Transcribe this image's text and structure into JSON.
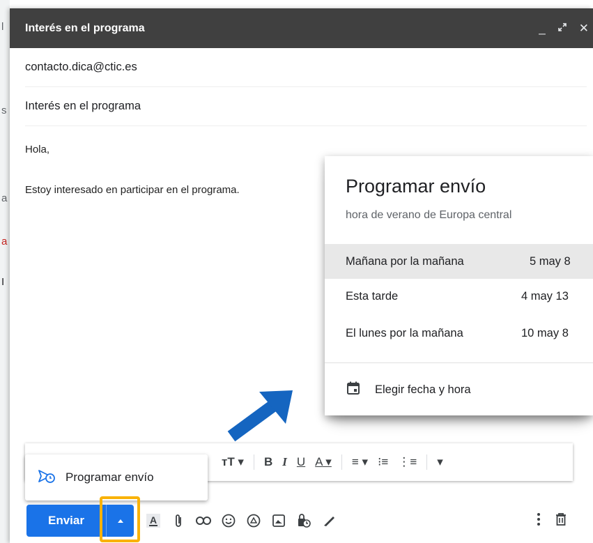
{
  "compose": {
    "title": "Interés en el programa",
    "to": "contacto.dica@ctic.es",
    "subject": "Interés en el programa",
    "body_greeting": "Hola,",
    "body_line": "Estoy interesado en participar en el programa."
  },
  "schedule_panel": {
    "title": "Programar envío",
    "timezone": "hora de verano de Europa central",
    "options": [
      {
        "label": "Mañana por la mañana",
        "time": "5 may 8"
      },
      {
        "label": "Esta tarde",
        "time": "4 may 13"
      },
      {
        "label": "El lunes por la mañana",
        "time": "10 may 8"
      }
    ],
    "custom_label": "Elegir fecha y hora"
  },
  "send_menu": {
    "item_label": "Programar envío"
  },
  "toolbar": {
    "send_label": "Enviar"
  },
  "colors": {
    "accent": "#1a73e8",
    "highlight": "#f9b208",
    "header": "#404040",
    "arrow": "#1565c0"
  }
}
